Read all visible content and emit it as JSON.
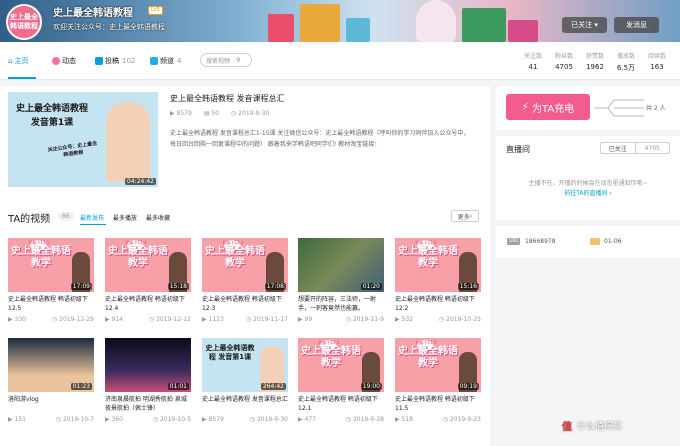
{
  "header": {
    "avatar_text": "史上最全韩语教程",
    "username": "史上最全韩语教程",
    "level": "LV5",
    "sign": "欢迎关注公众号：史上最全韩语教程",
    "followed_label": "已关注",
    "message_label": "发消息"
  },
  "nav": {
    "tabs": [
      {
        "label": "主页",
        "count": ""
      },
      {
        "label": "动态",
        "count": ""
      },
      {
        "label": "投稿",
        "count": "102"
      },
      {
        "label": "频道",
        "count": "4"
      }
    ],
    "search_placeholder": "搜索视频",
    "stats": [
      {
        "label": "关注数",
        "value": "41"
      },
      {
        "label": "粉丝数",
        "value": "4705"
      },
      {
        "label": "获赞数",
        "value": "1962"
      },
      {
        "label": "播放数",
        "value": "6.5万"
      },
      {
        "label": "阅读数",
        "value": "163"
      }
    ]
  },
  "featured": {
    "thumb_line1": "史上最全韩语教程",
    "thumb_line2": "发音第1课",
    "thumb_note": "关注公众号：史上最全韩语教程",
    "duration": "04:24:42",
    "title": "史上最全韩语教程 发音课程总汇",
    "plays": "8579",
    "danmaku": "50",
    "date": "2019-9-30",
    "desc": "史上最全韩语教程 发音课程总汇1-15课 关注微信公众号：史上最全韩语教程（呼叫你的学习同伴加入公众号中，每日回台回购一回复课程中的问题） 跟着我来学韩语吧同学们! 教材淘宝链接："
  },
  "videos_section": {
    "title": "TA的视频",
    "count": "86",
    "sort_new": "最新发布",
    "sort_play": "最多播放",
    "sort_fav": "最多收藏",
    "more_label": "更多"
  },
  "videos": [
    {
      "thumb_text": "史上最全韩语教学",
      "badge": "初级下12.5",
      "duration": "17:09",
      "title": "史上最全韩语教程 韩语初级下12.5",
      "plays": "330",
      "date": "2019-12-29"
    },
    {
      "thumb_text": "史上最全韩语教学",
      "badge": "初级下12.4",
      "duration": "15:18",
      "title": "史上最全韩语教程 韩语初级下12.4",
      "plays": "914",
      "date": "2019-12-12"
    },
    {
      "thumb_text": "史上最全韩语教学",
      "badge": "初级下12.3",
      "duration": "17:08",
      "title": "史上最全韩语教程 韩语初级下12.3",
      "plays": "1123",
      "date": "2019-11-17"
    },
    {
      "thumb_text": "",
      "badge": "",
      "duration": "01:20",
      "title": "想要开的阵容，三法师，一射手，一刺客竟然也能赢。",
      "plays": "99",
      "date": "2019-11-9"
    },
    {
      "thumb_text": "史上最全韩语教学",
      "badge": "初级下12.2",
      "duration": "15:16",
      "title": "史上最全韩语教程 韩语初级下12.2",
      "plays": "532",
      "date": "2019-10-25"
    },
    {
      "thumb_text": "",
      "badge": "",
      "duration": "01:23",
      "title": "洛阳游vlog",
      "plays": "151",
      "date": "2019-10-7"
    },
    {
      "thumb_text": "",
      "badge": "",
      "duration": "01:01",
      "title": "济南泉晨航拍 明湖秀航拍 泉城夜景航拍（佩士锋）",
      "plays": "360",
      "date": "2019-10-5"
    },
    {
      "thumb_text": "史上最全韩语教程 发音第1课",
      "badge": "",
      "duration": "264:42",
      "title": "史上最全韩语教程 发音课程总汇",
      "plays": "8579",
      "date": "2019-9-30"
    },
    {
      "thumb_text": "史上最全韩语教学",
      "badge": "初级下12.1",
      "duration": "19:00",
      "title": "史上最全韩语教程 韩语初级下12.1",
      "plays": "477",
      "date": "2019-9-28"
    },
    {
      "thumb_text": "史上最全韩语教学",
      "badge": "初级下11.5",
      "duration": "09:19",
      "title": "史上最全韩语教程 韩语初级下11.5",
      "plays": "518",
      "date": "2019-9-23"
    }
  ],
  "charge": {
    "button": "为TA充电",
    "count": "共 2 人"
  },
  "live": {
    "title": "直播间",
    "followed": "已关注",
    "fans": "4705",
    "note": "主播不在，开播的时候会在动态里通知你哦~",
    "link": "前往TA的直播间"
  },
  "info": {
    "uid_label": "UID",
    "uid": "18668978",
    "birthday": "01-06"
  },
  "watermark": "什么值得买",
  "colors": {
    "accent": "#00a1d6",
    "pink": "#f25d8e"
  }
}
